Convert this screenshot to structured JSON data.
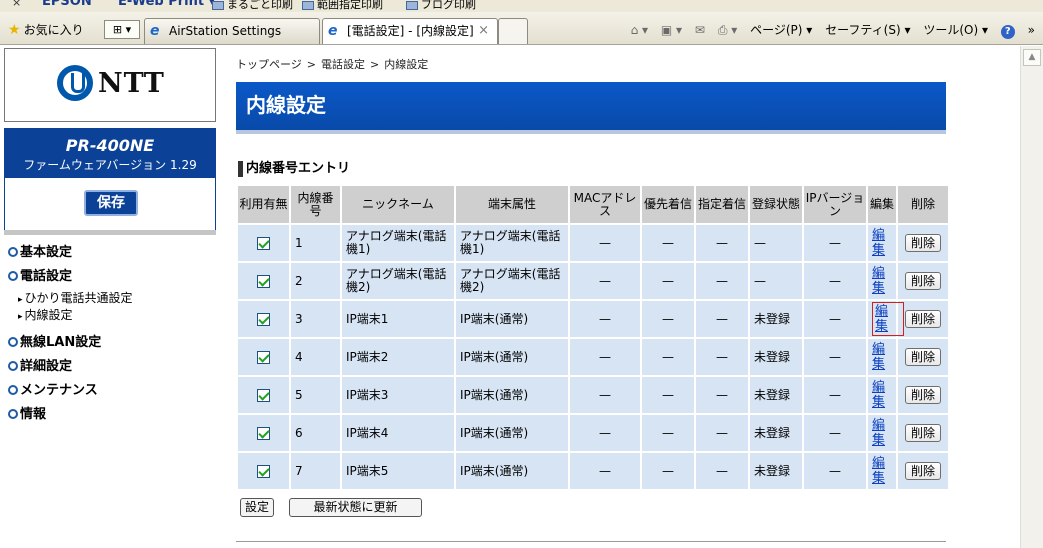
{
  "epson_bar": {
    "close": "×",
    "brand": "EPSON",
    "product": "E-Web Print ▾",
    "btn1": "まるごと印刷",
    "btn2": "範囲指定印刷",
    "btn3": "ブログ印刷"
  },
  "browser": {
    "favorites": "お気に入り",
    "quick_tabs": "⊞ ▾",
    "tabs": [
      {
        "title": "AirStation Settings",
        "active": false
      },
      {
        "title": "[電話設定] - [内線設定]",
        "active": true
      }
    ],
    "tab_close": "×",
    "commands": {
      "home": "⌂ ▾",
      "feeds": "▣ ▾",
      "mail": "✉",
      "print": "⎙ ▾",
      "page": "ページ(P) ▾",
      "safety": "セーフティ(S) ▾",
      "tools": "ツール(O) ▾",
      "help": "?",
      "more": "»"
    },
    "scroll_up": "▲"
  },
  "sidebar": {
    "logo_text": "NTT",
    "model": "PR-400NE",
    "firmware": "ファームウェアバージョン 1.29",
    "save_label": "保存",
    "nav": [
      {
        "label": "基本設定"
      },
      {
        "label": "電話設定",
        "subs": [
          "ひかり電話共通設定",
          "内線設定"
        ]
      },
      {
        "label": "無線LAN設定"
      },
      {
        "label": "詳細設定"
      },
      {
        "label": "メンテナンス"
      },
      {
        "label": "情報"
      }
    ],
    "sub_arrow": "▸"
  },
  "main": {
    "breadcrumb": [
      "トップページ",
      "電話設定",
      "内線設定"
    ],
    "breadcrumb_sep": ">",
    "title": "内線設定",
    "section": "内線番号エントリ",
    "table": {
      "headers": [
        "利用有無",
        "内線番号",
        "ニックネーム",
        "端末属性",
        "MACアドレス",
        "優先着信",
        "指定着信",
        "登録状態",
        "IPバージョン",
        "編集",
        "削除"
      ],
      "rows": [
        {
          "enabled": true,
          "ext": "1",
          "nickname": "アナログ端末(電話機1)",
          "attr": "アナログ端末(電話機1)",
          "mac": "—",
          "priority": "—",
          "designated": "—",
          "status": "—",
          "ipver": "—",
          "edit": "編集",
          "delete": "削除"
        },
        {
          "enabled": true,
          "ext": "2",
          "nickname": "アナログ端末(電話機2)",
          "attr": "アナログ端末(電話機2)",
          "mac": "—",
          "priority": "—",
          "designated": "—",
          "status": "—",
          "ipver": "—",
          "edit": "編集",
          "delete": "削除"
        },
        {
          "enabled": true,
          "ext": "3",
          "nickname": "IP端末1",
          "attr": "IP端末(通常)",
          "mac": "—",
          "priority": "—",
          "designated": "—",
          "status": "未登録",
          "ipver": "—",
          "edit": "編集",
          "delete": "削除",
          "focused": true
        },
        {
          "enabled": true,
          "ext": "4",
          "nickname": "IP端末2",
          "attr": "IP端末(通常)",
          "mac": "—",
          "priority": "—",
          "designated": "—",
          "status": "未登録",
          "ipver": "—",
          "edit": "編集",
          "delete": "削除"
        },
        {
          "enabled": true,
          "ext": "5",
          "nickname": "IP端末3",
          "attr": "IP端末(通常)",
          "mac": "—",
          "priority": "—",
          "designated": "—",
          "status": "未登録",
          "ipver": "—",
          "edit": "編集",
          "delete": "削除"
        },
        {
          "enabled": true,
          "ext": "6",
          "nickname": "IP端末4",
          "attr": "IP端末(通常)",
          "mac": "—",
          "priority": "—",
          "designated": "—",
          "status": "未登録",
          "ipver": "—",
          "edit": "編集",
          "delete": "削除"
        },
        {
          "enabled": true,
          "ext": "7",
          "nickname": "IP端末5",
          "attr": "IP端末(通常)",
          "mac": "—",
          "priority": "—",
          "designated": "—",
          "status": "未登録",
          "ipver": "—",
          "edit": "編集",
          "delete": "削除"
        }
      ]
    },
    "set_label": "設定",
    "refresh_label": "最新状態に更新"
  },
  "colors": {
    "title_bar": "#094aa9",
    "row_bg": "#d6e4f4",
    "header_bg": "#cfcfcf",
    "link": "#0a3ec0",
    "brand_blue": "#0058ac"
  }
}
